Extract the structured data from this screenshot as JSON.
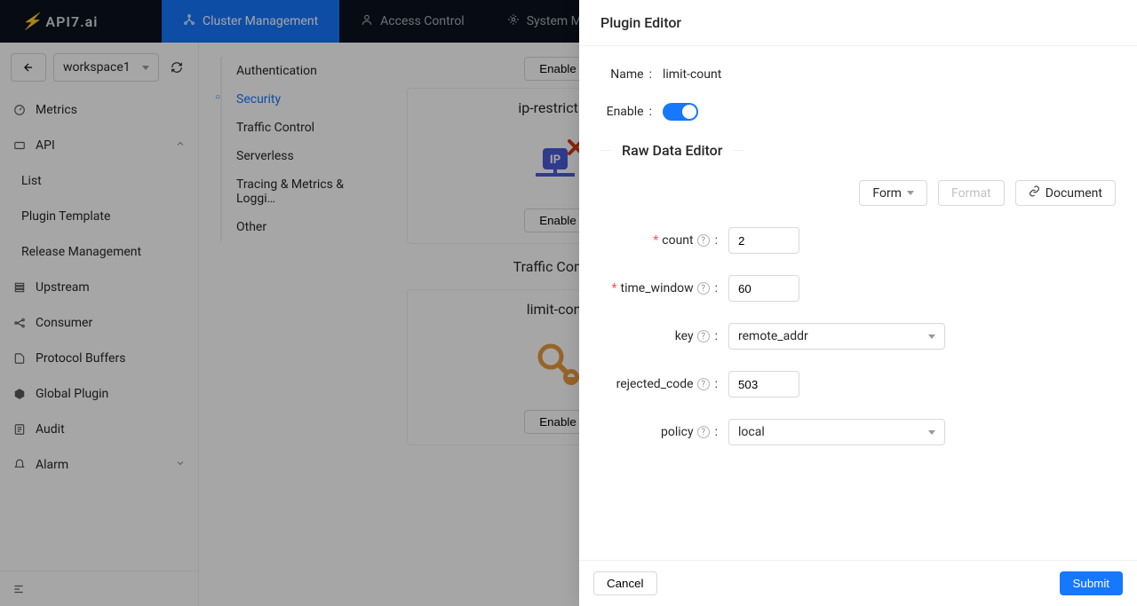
{
  "brand": "API7.ai",
  "topnav": {
    "items": [
      {
        "label": "Cluster Management",
        "active": true
      },
      {
        "label": "Access Control",
        "active": false
      },
      {
        "label": "System Ma",
        "active": false
      }
    ]
  },
  "workspace": {
    "selected": "workspace1"
  },
  "sidebar": {
    "items": [
      {
        "label": "Metrics",
        "icon": "gauge"
      },
      {
        "label": "API",
        "icon": "api",
        "expandable": true,
        "expanded": true,
        "children": [
          {
            "label": "List"
          },
          {
            "label": "Plugin Template"
          },
          {
            "label": "Release Management"
          }
        ]
      },
      {
        "label": "Upstream",
        "icon": "stack"
      },
      {
        "label": "Consumer",
        "icon": "nodes"
      },
      {
        "label": "Protocol Buffers",
        "icon": "file"
      },
      {
        "label": "Global Plugin",
        "icon": "cube"
      },
      {
        "label": "Audit",
        "icon": "audit"
      },
      {
        "label": "Alarm",
        "icon": "bell",
        "expandable": true
      }
    ]
  },
  "categories": {
    "items": [
      {
        "label": "Authentication"
      },
      {
        "label": "Security",
        "active": true
      },
      {
        "label": "Traffic Control"
      },
      {
        "label": "Serverless"
      },
      {
        "label": "Tracing & Metrics & Loggi…"
      },
      {
        "label": "Other"
      }
    ]
  },
  "content": {
    "enable_label": "Enable",
    "cards": [
      {
        "title": "ip-restriction",
        "section": ""
      },
      {
        "title": "limit-conn",
        "section": "Traffic Control"
      }
    ]
  },
  "drawer": {
    "title": "Plugin Editor",
    "name_label": "Name",
    "name_value": "limit-count",
    "enable_label": "Enable",
    "enable_value": true,
    "section_title": "Raw Data Editor",
    "actions": {
      "form": "Form",
      "format": "Format",
      "document": "Document"
    },
    "fields": {
      "count": {
        "label": "count",
        "value": "2",
        "required": true
      },
      "time_window": {
        "label": "time_window",
        "value": "60",
        "required": true
      },
      "key": {
        "label": "key",
        "value": "remote_addr"
      },
      "rejected_code": {
        "label": "rejected_code",
        "value": "503"
      },
      "policy": {
        "label": "policy",
        "value": "local"
      }
    },
    "footer": {
      "cancel": "Cancel",
      "submit": "Submit"
    }
  }
}
